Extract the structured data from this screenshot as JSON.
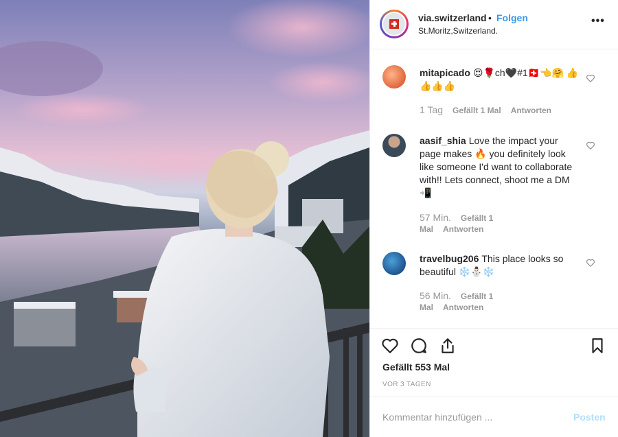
{
  "post": {
    "username": "via.switzerland",
    "separator": "•",
    "follow_label": "Folgen",
    "location": "St.Moritz,Switzerland.",
    "more_icon": "more-horizontal-icon",
    "more_label": "•••"
  },
  "comments": [
    {
      "user": "mitapicado",
      "text": "😍🌹ch🖤#1🇨🇭👈🤗 👍👍👍👍",
      "time": "1 Tag",
      "likes": "Gefällt 1 Mal",
      "reply": "Antworten"
    },
    {
      "user": "aasif_shia",
      "text": "Love the impact your page makes 🔥 you definitely look like someone I'd want to collaborate with!! Lets connect, shoot me a DM📲",
      "time": "57 Min.",
      "likes": "Gefällt 1 Mal",
      "reply": "Antworten"
    },
    {
      "user": "travelbug206",
      "text": "This place looks so beautiful ❄️⛄❄️",
      "time": "56 Min.",
      "likes": "Gefällt 1 Mal",
      "reply": "Antworten"
    }
  ],
  "actions": {
    "likes_text": "Gefällt 553 Mal",
    "date_text": "VOR 3 TAGEN"
  },
  "add_comment": {
    "placeholder": "Kommentar hinzufügen ...",
    "post_label": "Posten"
  },
  "colors": {
    "accent": "#3897f0",
    "post_disabled": "#b2dffc",
    "muted": "#999999"
  }
}
